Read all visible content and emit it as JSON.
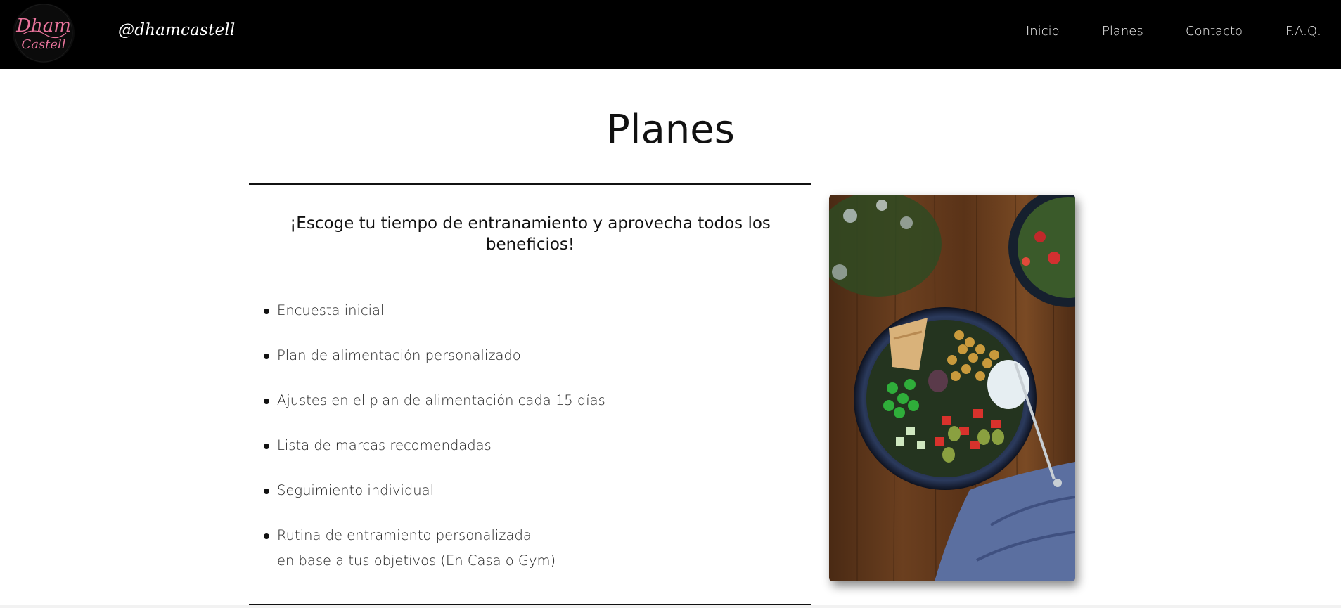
{
  "header": {
    "logo_alt": "Dham Castell",
    "logo_text_top": "Dham",
    "logo_text_bottom": "Castell",
    "handle": "@dhamcastell",
    "nav": [
      {
        "label": "Inicio"
      },
      {
        "label": "Planes"
      },
      {
        "label": "Contacto"
      },
      {
        "label": "F.A.Q."
      }
    ]
  },
  "main": {
    "title": "Planes",
    "subtitle": "¡Escoge tu tiempo de entranamiento y aprovecha todos los beneficios!",
    "features": [
      {
        "line1": "Encuesta inicial",
        "line2": ""
      },
      {
        "line1": "Plan de alimentación personalizado",
        "line2": ""
      },
      {
        "line1": "Ajustes en el plan de alimentación cada 15 días",
        "line2": ""
      },
      {
        "line1": "Lista de marcas recomendadas",
        "line2": ""
      },
      {
        "line1": "Seguimiento individual",
        "line2": ""
      },
      {
        "line1": "Rutina de entramiento personalizada",
        "line2": "en base a tus objetivos (En Casa o Gym)"
      }
    ]
  },
  "colors": {
    "header_bg": "#000000",
    "logo_pink": "#e8739b",
    "page_bg": "#ffffff"
  }
}
